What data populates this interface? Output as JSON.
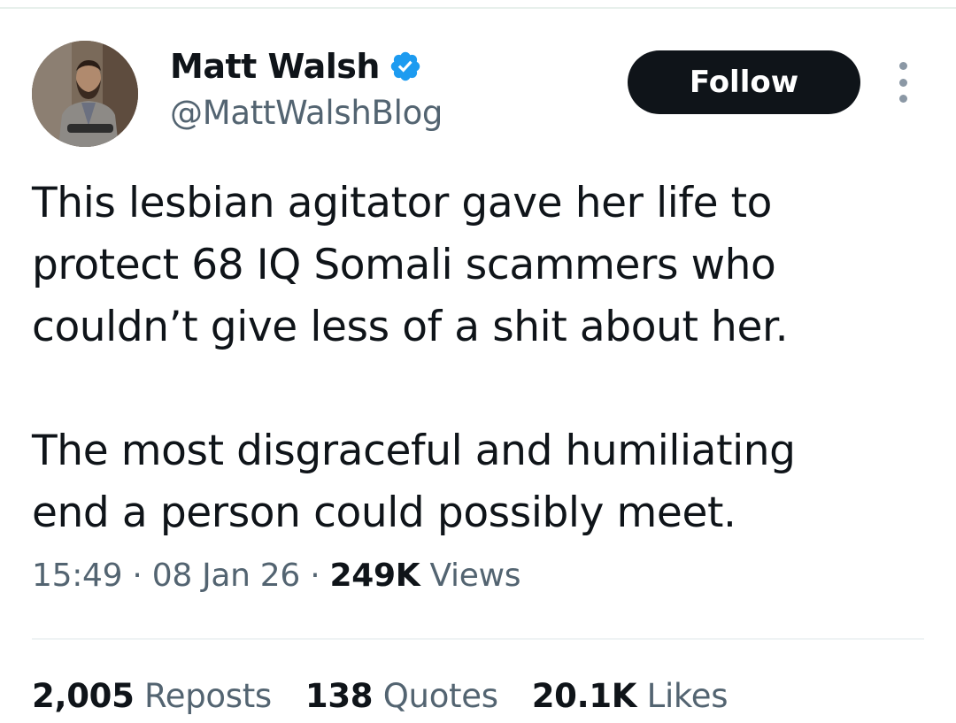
{
  "author": {
    "display_name": "Matt Walsh",
    "handle": "@MattWalshBlog",
    "verified": true,
    "verified_color": "#1d9bf0",
    "avatar_icon": "profile-photo"
  },
  "follow_button": {
    "label": "Follow"
  },
  "more_button": {
    "icon": "more-vertical-icon"
  },
  "tweet": {
    "paragraph_1": "This lesbian agitator gave her life to\nprotect 68 IQ Somali scammers who\ncouldn’t give less of a shit about her.",
    "paragraph_2": "The most disgraceful and humiliating\nend a person could possibly meet."
  },
  "meta": {
    "time": "15:49",
    "separator": "·",
    "date": "08 Jan 26",
    "views_count": "249K",
    "views_label": "Views"
  },
  "stats": {
    "reposts_count": "2,005",
    "reposts_label": "Reposts",
    "quotes_count": "138",
    "quotes_label": "Quotes",
    "likes_count": "20.1K",
    "likes_label": "Likes"
  },
  "colors": {
    "text_primary": "#0f1419",
    "text_secondary": "#536471",
    "follow_bg": "#0f1419",
    "follow_text": "#ffffff"
  }
}
